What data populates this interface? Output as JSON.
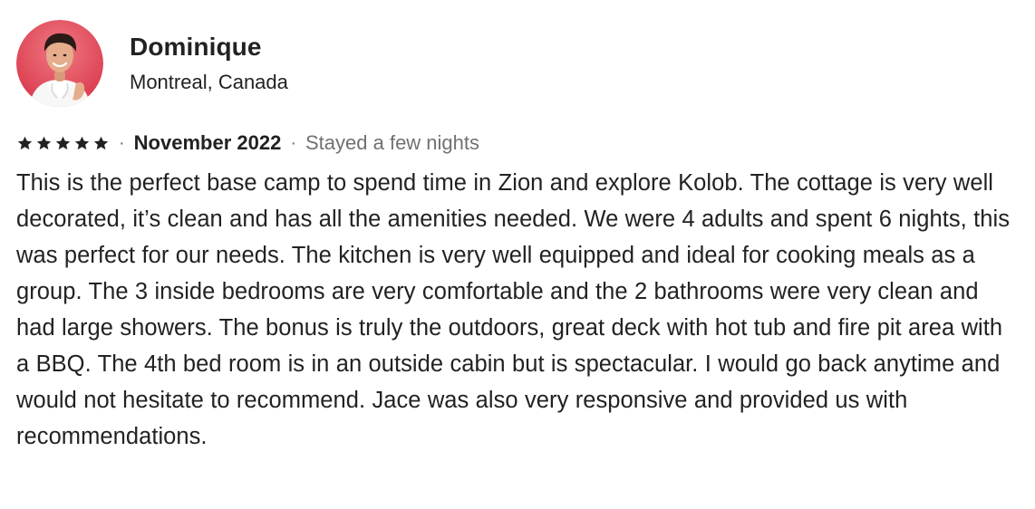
{
  "reviewer": {
    "name": "Dominique",
    "location": "Montreal, Canada",
    "avatar_icon": "reviewer-avatar"
  },
  "rating": {
    "stars": 5,
    "max_stars": 5,
    "star_color": "#222222"
  },
  "meta": {
    "separator": "·",
    "date": "November 2022",
    "stay": "Stayed a few nights"
  },
  "review_text": "This is the perfect base camp to spend time in Zion and explore Kolob. The cottage is very well decorated, it’s clean and has all the amenities needed. We were 4 adults and spent 6 nights, this was perfect for our needs. The kitchen is very well equipped and ideal for cooking meals as a group. The 3 inside bedrooms are very comfortable and the 2 bathrooms were very clean and had large showers. The bonus is truly the outdoors, great deck with hot tub and fire pit area with a BBQ. The 4th bed room is in an outside cabin but is spectacular. I would go back anytime and would not hesitate to recommend. Jace was also very responsive and provided us with recommendations.",
  "colors": {
    "text_primary": "#222222",
    "text_secondary": "#717171",
    "avatar_background": "#e44a5a"
  }
}
